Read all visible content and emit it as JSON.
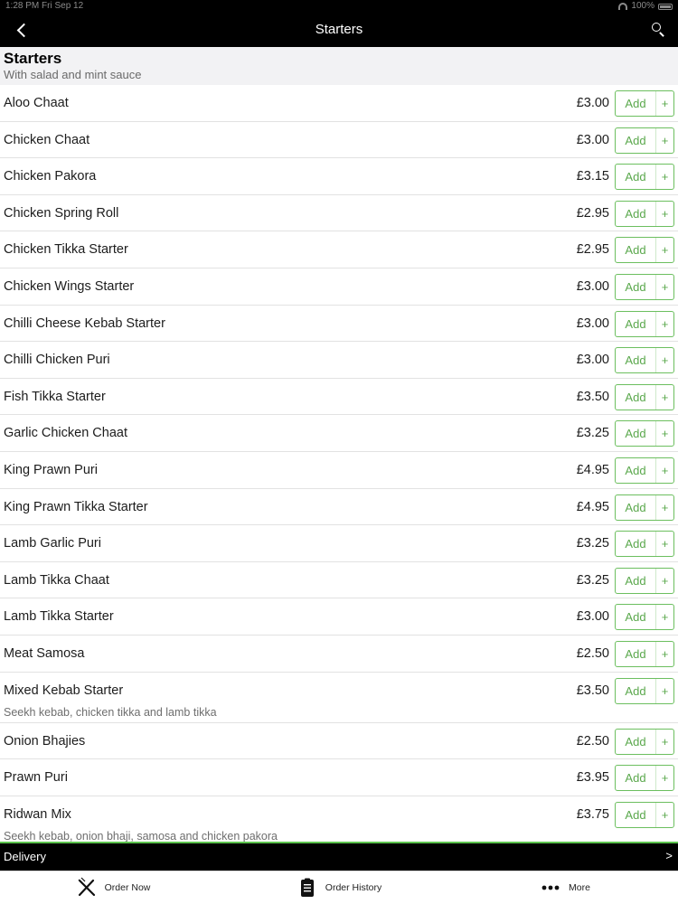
{
  "status_bar": {
    "time": "1:28 PM  Fri Sep 12",
    "battery": "100%"
  },
  "nav": {
    "title": "Starters"
  },
  "section": {
    "title": "Starters",
    "subtitle": "With salad and mint sauce"
  },
  "add_label": "Add",
  "plus_label": "+",
  "items": [
    {
      "name": "Aloo Chaat",
      "price": "£3.00",
      "desc": ""
    },
    {
      "name": "Chicken Chaat",
      "price": "£3.00",
      "desc": ""
    },
    {
      "name": "Chicken Pakora",
      "price": "£3.15",
      "desc": ""
    },
    {
      "name": "Chicken Spring Roll",
      "price": "£2.95",
      "desc": ""
    },
    {
      "name": "Chicken Tikka Starter",
      "price": "£2.95",
      "desc": ""
    },
    {
      "name": "Chicken Wings Starter",
      "price": "£3.00",
      "desc": ""
    },
    {
      "name": "Chilli Cheese Kebab Starter",
      "price": "£3.00",
      "desc": ""
    },
    {
      "name": "Chilli Chicken Puri",
      "price": "£3.00",
      "desc": ""
    },
    {
      "name": "Fish Tikka Starter",
      "price": "£3.50",
      "desc": ""
    },
    {
      "name": "Garlic Chicken Chaat",
      "price": "£3.25",
      "desc": ""
    },
    {
      "name": "King Prawn Puri",
      "price": "£4.95",
      "desc": ""
    },
    {
      "name": "King Prawn Tikka Starter",
      "price": "£4.95",
      "desc": ""
    },
    {
      "name": "Lamb Garlic Puri",
      "price": "£3.25",
      "desc": ""
    },
    {
      "name": "Lamb Tikka Chaat",
      "price": "£3.25",
      "desc": ""
    },
    {
      "name": "Lamb Tikka Starter",
      "price": "£3.00",
      "desc": ""
    },
    {
      "name": "Meat Samosa",
      "price": "£2.50",
      "desc": ""
    },
    {
      "name": "Mixed Kebab Starter",
      "price": "£3.50",
      "desc": "Seekh kebab, chicken tikka and lamb tikka"
    },
    {
      "name": "Onion Bhajies",
      "price": "£2.50",
      "desc": ""
    },
    {
      "name": "Prawn Puri",
      "price": "£3.95",
      "desc": ""
    },
    {
      "name": "Ridwan Mix",
      "price": "£3.75",
      "desc": "Seekh kebab, onion bhaji, samosa and chicken pakora"
    }
  ],
  "delivery": {
    "label": "Delivery",
    "arrow": ">"
  },
  "tabs": [
    {
      "label": "Order Now",
      "icon": "fork-knife-icon"
    },
    {
      "label": "Order History",
      "icon": "clipboard-icon"
    },
    {
      "label": "More",
      "icon": "more-dots-icon"
    }
  ],
  "colors": {
    "accent_green": "#5aa84c",
    "bar_black": "#000000",
    "divider_green": "#5cc34e"
  }
}
